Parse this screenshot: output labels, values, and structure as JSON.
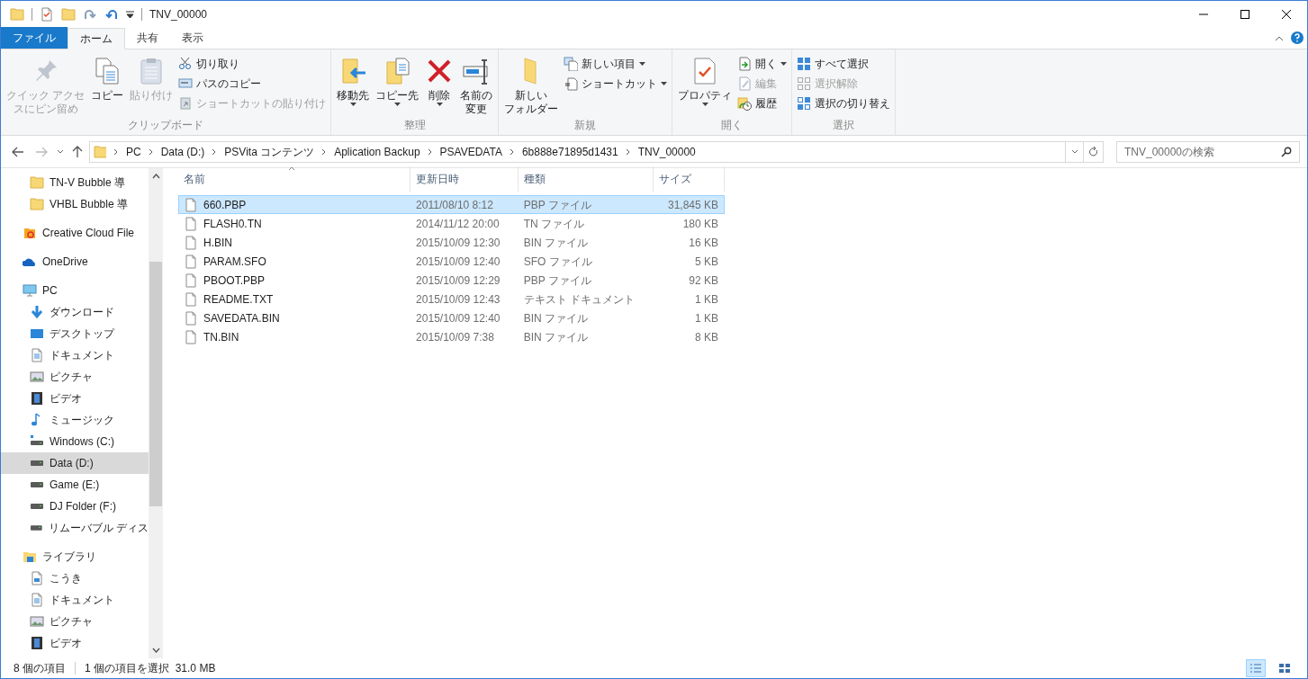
{
  "window": {
    "title": "TNV_00000"
  },
  "tabs": [
    {
      "label": "ファイル",
      "kind": "file",
      "selected": false
    },
    {
      "label": "ホーム",
      "kind": "tab",
      "selected": true
    },
    {
      "label": "共有",
      "kind": "tab",
      "selected": false
    },
    {
      "label": "表示",
      "kind": "tab",
      "selected": false
    }
  ],
  "ribbon": {
    "groups": [
      {
        "label": "クリップボード",
        "items": [
          {
            "kind": "large",
            "label_lines": [
              "クイック アクセ",
              "スにピン留め"
            ],
            "disabled": true,
            "dropdown": false
          },
          {
            "kind": "large",
            "label": "コピー",
            "disabled": false,
            "dropdown": false
          },
          {
            "kind": "large",
            "label": "貼り付け",
            "disabled": true,
            "dropdown": false
          },
          {
            "kind": "small",
            "label": "切り取り",
            "disabled": false,
            "dropdown": false
          },
          {
            "kind": "small",
            "label": "パスのコピー",
            "disabled": false,
            "dropdown": false
          },
          {
            "kind": "small",
            "label": "ショートカットの貼り付け",
            "disabled": true,
            "dropdown": false
          }
        ]
      },
      {
        "label": "整理",
        "items": [
          {
            "kind": "large",
            "label": "移動先",
            "disabled": false,
            "dropdown": true
          },
          {
            "kind": "large",
            "label": "コピー先",
            "disabled": false,
            "dropdown": true
          },
          {
            "kind": "large",
            "label": "削除",
            "disabled": false,
            "dropdown": true
          },
          {
            "kind": "large",
            "label_lines": [
              "名前の",
              "変更"
            ],
            "disabled": false,
            "dropdown": false
          }
        ]
      },
      {
        "label": "新規",
        "items": [
          {
            "kind": "large",
            "label_lines": [
              "新しい",
              "フォルダー"
            ],
            "disabled": false,
            "dropdown": false
          },
          {
            "kind": "small",
            "label": "新しい項目",
            "disabled": false,
            "dropdown": true
          },
          {
            "kind": "small",
            "label": "ショートカット",
            "disabled": false,
            "dropdown": true
          }
        ]
      },
      {
        "label": "開く",
        "items": [
          {
            "kind": "large",
            "label": "プロパティ",
            "disabled": false,
            "dropdown": true
          },
          {
            "kind": "small",
            "label": "開く",
            "disabled": false,
            "dropdown": true
          },
          {
            "kind": "small",
            "label": "編集",
            "disabled": true,
            "dropdown": false
          },
          {
            "kind": "small",
            "label": "履歴",
            "disabled": false,
            "dropdown": false
          }
        ]
      },
      {
        "label": "選択",
        "items": [
          {
            "kind": "small",
            "label": "すべて選択",
            "disabled": false,
            "dropdown": false
          },
          {
            "kind": "small",
            "label": "選択解除",
            "disabled": true,
            "dropdown": false
          },
          {
            "kind": "small",
            "label": "選択の切り替え",
            "disabled": false,
            "dropdown": false
          }
        ]
      }
    ]
  },
  "address_bar": {
    "path": [
      "PC",
      "Data (D:)",
      "PSVita コンテンツ",
      "Aplication Backup",
      "PSAVEDATA",
      "6b888e71895d1431",
      "TNV_00000"
    ]
  },
  "search": {
    "placeholder": "TNV_00000の検索"
  },
  "sidebar": {
    "sections": [
      {
        "children": [
          {
            "label": "TN-V Bubble 導",
            "selected": false
          },
          {
            "label": "VHBL Bubble 導",
            "selected": false
          }
        ]
      },
      {
        "label": "Creative Cloud File",
        "selected": false
      },
      {
        "label": "OneDrive",
        "selected": false
      },
      {
        "label": "PC",
        "selected": false,
        "children": [
          {
            "label": "ダウンロード",
            "selected": false
          },
          {
            "label": "デスクトップ",
            "selected": false
          },
          {
            "label": "ドキュメント",
            "selected": false
          },
          {
            "label": "ピクチャ",
            "selected": false
          },
          {
            "label": "ビデオ",
            "selected": false
          },
          {
            "label": "ミュージック",
            "selected": false
          },
          {
            "label": "Windows (C:)",
            "selected": false
          },
          {
            "label": "Data (D:)",
            "selected": true
          },
          {
            "label": "Game (E:)",
            "selected": false
          },
          {
            "label": "DJ Folder (F:)",
            "selected": false
          },
          {
            "label": "リムーバブル ディス",
            "selected": false
          }
        ]
      },
      {
        "label": "ライブラリ",
        "selected": false,
        "children": [
          {
            "label": "こうき",
            "selected": false
          },
          {
            "label": "ドキュメント",
            "selected": false
          },
          {
            "label": "ピクチャ",
            "selected": false
          },
          {
            "label": "ビデオ",
            "selected": false
          }
        ]
      }
    ]
  },
  "table": {
    "columns": [
      "名前",
      "更新日時",
      "種類",
      "サイズ"
    ],
    "rows": [
      {
        "name": "660.PBP",
        "modified": "2011/08/10 8:12",
        "type": "PBP ファイル",
        "size": "31,845 KB",
        "selected": true
      },
      {
        "name": "FLASH0.TN",
        "modified": "2014/11/12 20:00",
        "type": "TN ファイル",
        "size": "180 KB",
        "selected": false
      },
      {
        "name": "H.BIN",
        "modified": "2015/10/09 12:30",
        "type": "BIN ファイル",
        "size": "16 KB",
        "selected": false
      },
      {
        "name": "PARAM.SFO",
        "modified": "2015/10/09 12:40",
        "type": "SFO ファイル",
        "size": "5 KB",
        "selected": false
      },
      {
        "name": "PBOOT.PBP",
        "modified": "2015/10/09 12:29",
        "type": "PBP ファイル",
        "size": "92 KB",
        "selected": false
      },
      {
        "name": "README.TXT",
        "modified": "2015/10/09 12:43",
        "type": "テキスト ドキュメント",
        "size": "1 KB",
        "selected": false
      },
      {
        "name": "SAVEDATA.BIN",
        "modified": "2015/10/09 12:40",
        "type": "BIN ファイル",
        "size": "1 KB",
        "selected": false
      },
      {
        "name": "TN.BIN",
        "modified": "2015/10/09 7:38",
        "type": "BIN ファイル",
        "size": "8 KB",
        "selected": false
      }
    ]
  },
  "status_bar": {
    "item_count": "8 個の項目",
    "selection": "1 個の項目を選択  31.0 MB"
  },
  "view_buttons": [
    {
      "kind": "details",
      "selected": true
    },
    {
      "kind": "tiles",
      "selected": false
    }
  ]
}
